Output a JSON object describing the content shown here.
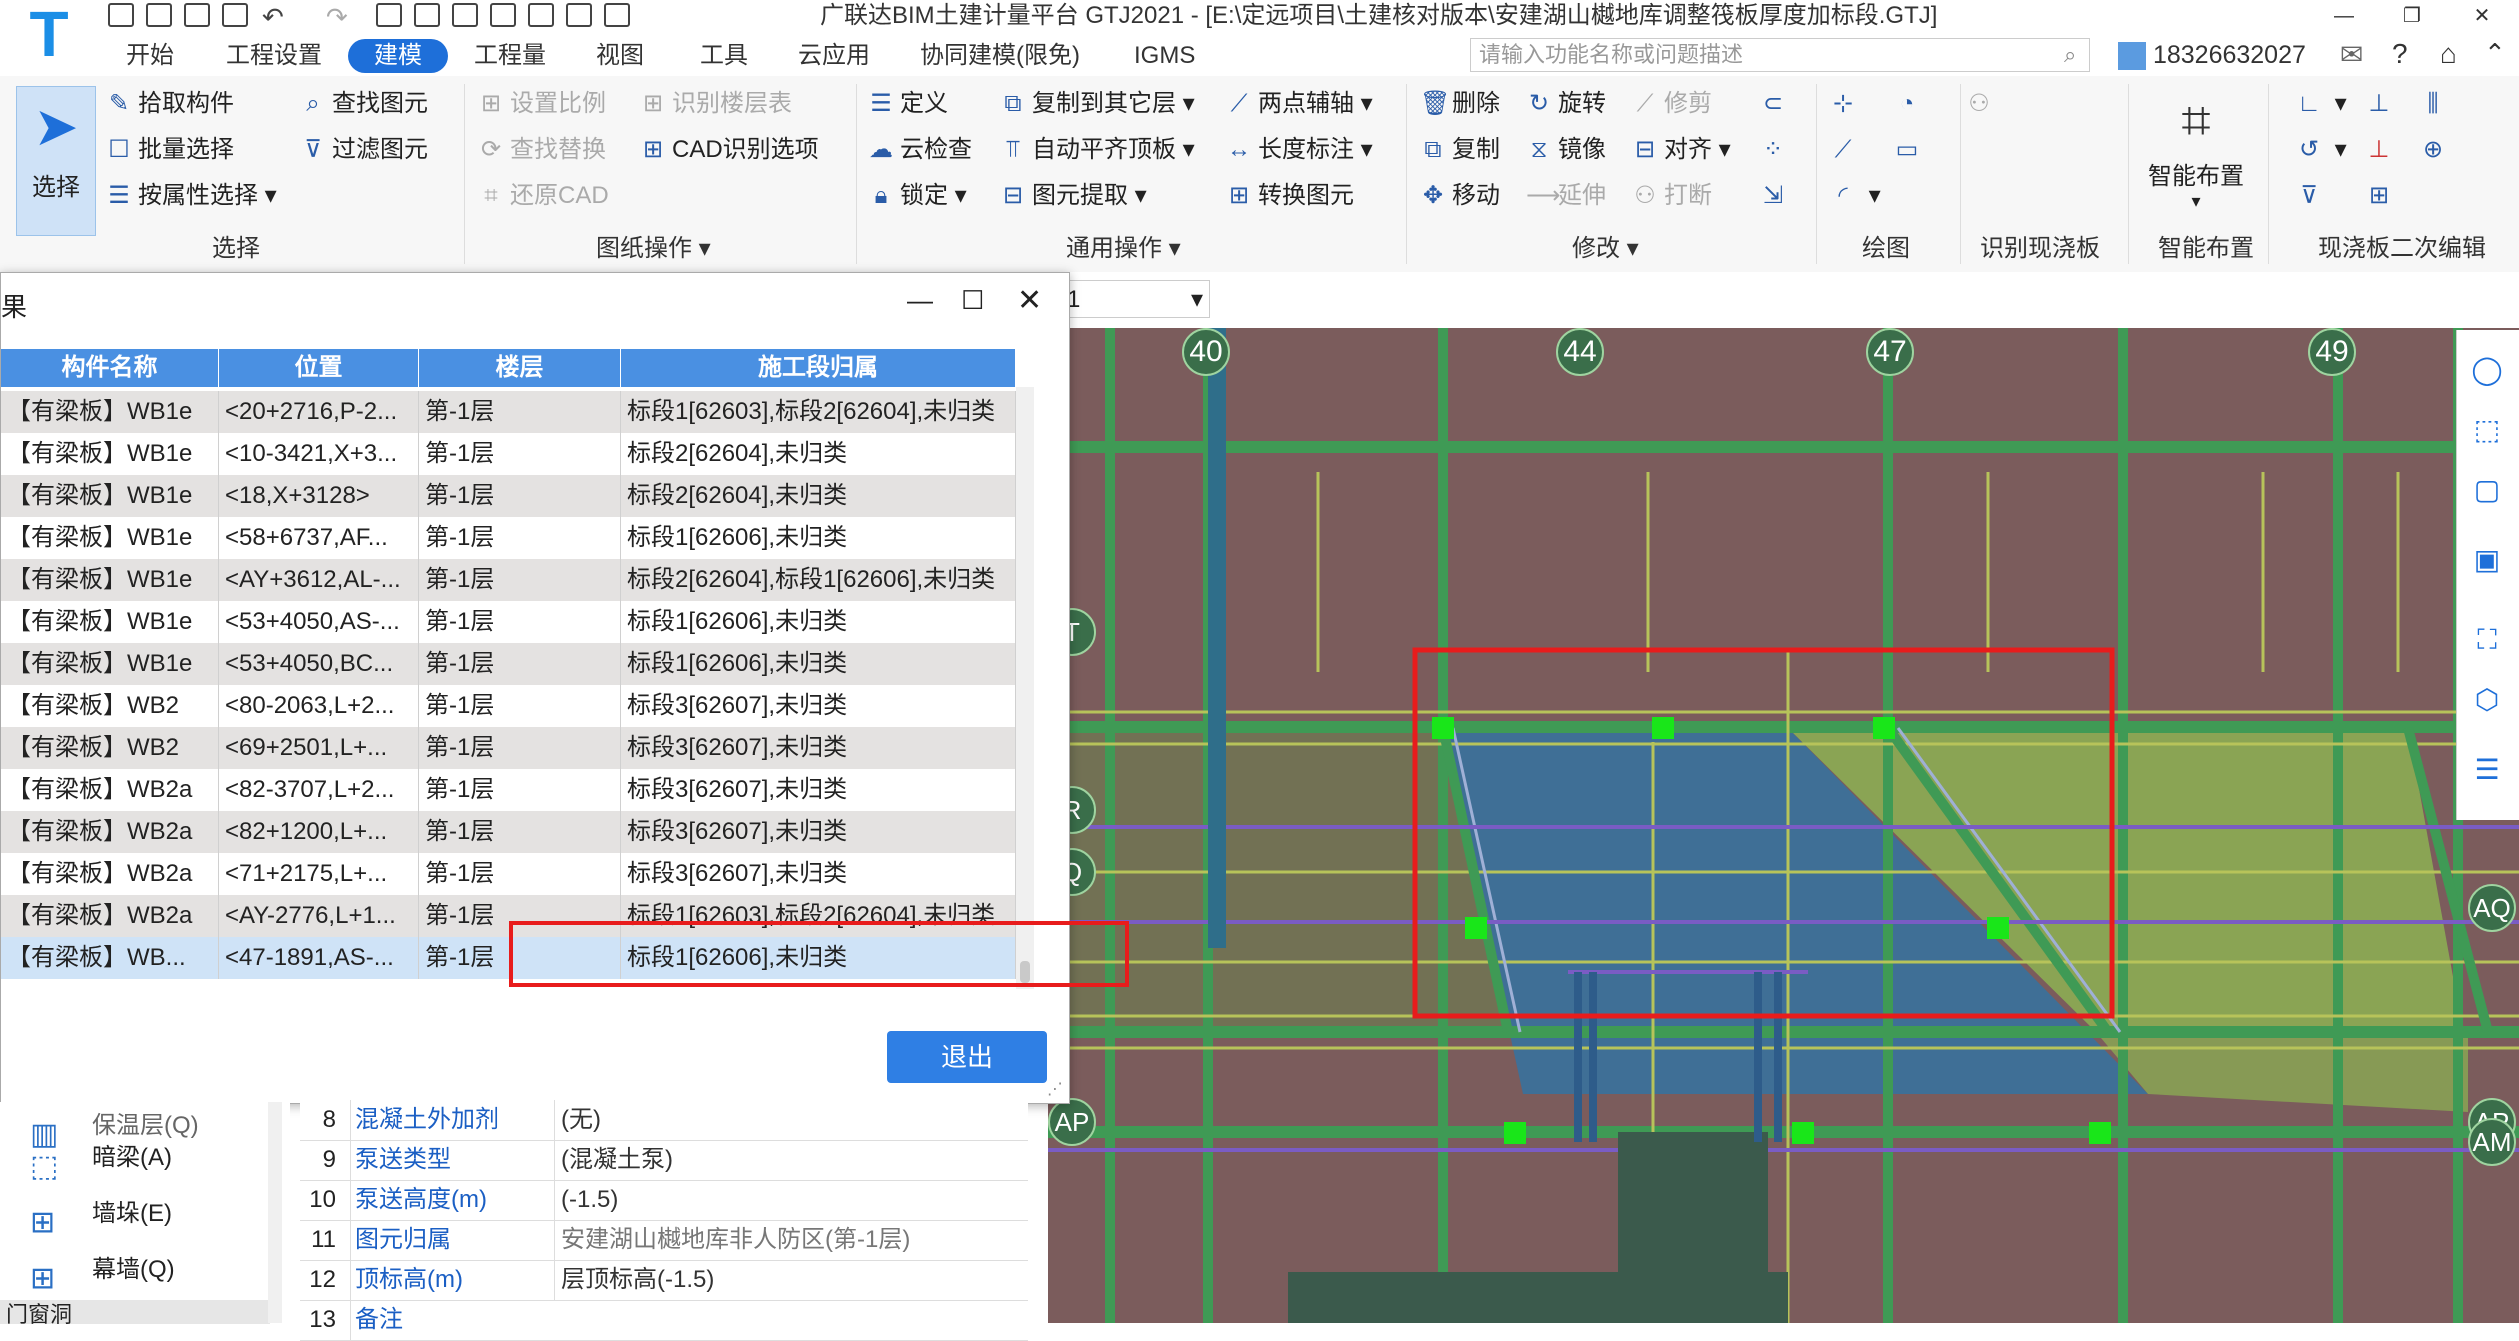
{
  "window": {
    "title": "广联达BIM土建计量平台 GTJ2021 - [E:\\定远项目\\土建核对版本\\安建湖山樾地库调整筏板厚度加标段.GTJ]",
    "logo": "T"
  },
  "menu": {
    "items": [
      "开始",
      "工程设置",
      "建模",
      "工程量",
      "视图",
      "工具",
      "云应用",
      "协同建模(限免)",
      "IGMS"
    ],
    "active": "建模",
    "search_placeholder": "请输入功能名称或问题描述",
    "user_phone": "18326632027"
  },
  "ribbon": {
    "select_big": "选择",
    "select_group": [
      "拾取构件",
      "批量选择",
      "按属性选择",
      "查找图元",
      "过滤图元"
    ],
    "select_label": "选择",
    "cad_group": [
      "设置比例",
      "识别楼层表",
      "查找替换",
      "CAD识别选项",
      "还原CAD"
    ],
    "cad_label": "图纸操作",
    "common_group": [
      "定义",
      "复制到其它层",
      "两点辅轴",
      "云检查",
      "自动平齐顶板",
      "长度标注",
      "锁定",
      "图元提取",
      "转换图元"
    ],
    "common_label": "通用操作",
    "modify_group": [
      "删除",
      "旋转",
      "修剪",
      "复制",
      "镜像",
      "对齐",
      "移动",
      "延伸",
      "打断"
    ],
    "modify_label": "修改",
    "draw_label": "绘图",
    "recognize_label": "识别现浇板",
    "smart_big": "智能布置",
    "smart_label": "智能布置",
    "secondary_label": "现浇板二次编辑"
  },
  "floor_selector": "1",
  "dialog": {
    "title": "果",
    "columns": [
      "构件名称",
      "位置",
      "楼层",
      "施工段归属"
    ],
    "rows": [
      {
        "name": "【有梁板】WB1e",
        "pos": "<20+2716,P-2...",
        "floor": "第-1层",
        "seg": "标段1[62603],标段2[62604],未归类"
      },
      {
        "name": "【有梁板】WB1e",
        "pos": "<10-3421,X+3...",
        "floor": "第-1层",
        "seg": "标段2[62604],未归类"
      },
      {
        "name": "【有梁板】WB1e",
        "pos": "<18,X+3128>",
        "floor": "第-1层",
        "seg": "标段2[62604],未归类"
      },
      {
        "name": "【有梁板】WB1e",
        "pos": "<58+6737,AF...",
        "floor": "第-1层",
        "seg": "标段1[62606],未归类"
      },
      {
        "name": "【有梁板】WB1e",
        "pos": "<AY+3612,AL-...",
        "floor": "第-1层",
        "seg": "标段2[62604],标段1[62606],未归类"
      },
      {
        "name": "【有梁板】WB1e",
        "pos": "<53+4050,AS-...",
        "floor": "第-1层",
        "seg": "标段1[62606],未归类"
      },
      {
        "name": "【有梁板】WB1e",
        "pos": "<53+4050,BC...",
        "floor": "第-1层",
        "seg": "标段1[62606],未归类"
      },
      {
        "name": "【有梁板】WB2",
        "pos": "<80-2063,L+2...",
        "floor": "第-1层",
        "seg": "标段3[62607],未归类"
      },
      {
        "name": "【有梁板】WB2",
        "pos": "<69+2501,L+...",
        "floor": "第-1层",
        "seg": "标段3[62607],未归类"
      },
      {
        "name": "【有梁板】WB2a",
        "pos": "<82-3707,L+2...",
        "floor": "第-1层",
        "seg": "标段3[62607],未归类"
      },
      {
        "name": "【有梁板】WB2a",
        "pos": "<82+1200,L+...",
        "floor": "第-1层",
        "seg": "标段3[62607],未归类"
      },
      {
        "name": "【有梁板】WB2a",
        "pos": "<71+2175,L+...",
        "floor": "第-1层",
        "seg": "标段3[62607],未归类"
      },
      {
        "name": "【有梁板】WB2a",
        "pos": "<AY-2776,L+1...",
        "floor": "第-1层",
        "seg": "标段1[62603],标段2[62604],未归类"
      },
      {
        "name": "【有梁板】WB...",
        "pos": "<47-1891,AS-...",
        "floor": "第-1层",
        "seg": "标段1[62606],未归类"
      }
    ],
    "exit_label": "退出"
  },
  "left_panel": {
    "items": [
      "保温层(Q)",
      "暗梁(A)",
      "墙垛(E)",
      "幕墙(Q)",
      "门窗洞"
    ]
  },
  "properties": [
    {
      "n": "8",
      "k": "混凝土外加剂",
      "v": "(无)"
    },
    {
      "n": "9",
      "k": "泵送类型",
      "v": "(混凝土泵)"
    },
    {
      "n": "10",
      "k": "泵送高度(m)",
      "v": "(-1.5)"
    },
    {
      "n": "11",
      "k": "图元归属",
      "v": "安建湖山樾地库非人防区(第-1层)"
    },
    {
      "n": "12",
      "k": "顶标高(m)",
      "v": "层顶标高(-1.5)"
    },
    {
      "n": "13",
      "k": "备注",
      "v": ""
    }
  ],
  "canvas": {
    "axis_labels_top": [
      "40",
      "44",
      "47",
      "49"
    ],
    "axis_labels_side": [
      "AQ",
      "AP",
      "AP",
      "AM",
      "R",
      "Q",
      "T"
    ],
    "colors": {
      "background": "#7b5c5c",
      "beam": "#3f9a55",
      "slab_blue": "#3f6f96",
      "slab_green": "#8aa454",
      "highlight": "#e81c1c",
      "grip": "#19e619"
    }
  }
}
